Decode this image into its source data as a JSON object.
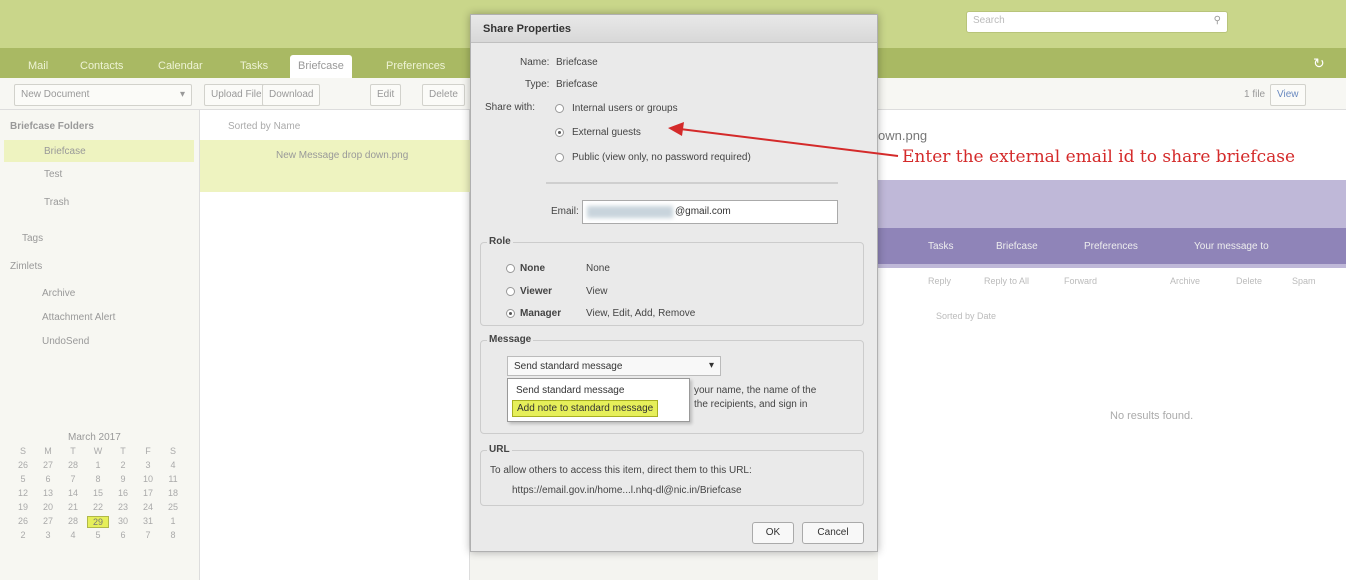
{
  "topbar": {
    "search_placeholder": "Search"
  },
  "nav": {
    "tabs": [
      "Mail",
      "Contacts",
      "Calendar",
      "Tasks",
      "Briefcase",
      "Preferences"
    ],
    "active": "Briefcase"
  },
  "toolbar": {
    "new_document": "New Document",
    "upload": "Upload File",
    "download": "Download",
    "edit": "Edit",
    "delete": "Delete",
    "file_count": "1 file",
    "view": "View"
  },
  "sidebar": {
    "folders_header": "Briefcase Folders",
    "folders": [
      "Briefcase",
      "Test",
      "Trash"
    ],
    "tags_header": "Tags",
    "zimlets_header": "Zimlets",
    "zimlets": [
      "Archive",
      "Attachment Alert",
      "UndoSend"
    ]
  },
  "calendar": {
    "month": "March 2017",
    "days": [
      "S",
      "M",
      "T",
      "W",
      "T",
      "F",
      "S"
    ],
    "weeks": [
      [
        "26",
        "27",
        "28",
        "1",
        "2",
        "3",
        "4"
      ],
      [
        "5",
        "6",
        "7",
        "8",
        "9",
        "10",
        "11"
      ],
      [
        "12",
        "13",
        "14",
        "15",
        "16",
        "17",
        "18"
      ],
      [
        "19",
        "20",
        "21",
        "22",
        "23",
        "24",
        "25"
      ],
      [
        "26",
        "27",
        "28",
        "29",
        "30",
        "31",
        "1"
      ],
      [
        "2",
        "3",
        "4",
        "5",
        "6",
        "7",
        "8"
      ]
    ],
    "today": "29"
  },
  "filelist": {
    "sort_label": "Sorted by Name",
    "file_name": "New Message drop down.png"
  },
  "preview": {
    "title_fragment": "own.png",
    "tabs": [
      "Tasks",
      "Briefcase",
      "Preferences",
      "Your message to"
    ],
    "actions": [
      "Reply",
      "Reply to All",
      "Forward",
      "Archive",
      "Delete",
      "Spam"
    ],
    "sort_label": "Sorted by Date",
    "no_results": "No results found."
  },
  "dialog": {
    "title": "Share Properties",
    "name_label": "Name:",
    "name_value": "Briefcase",
    "type_label": "Type:",
    "type_value": "Briefcase",
    "share_with_label": "Share with:",
    "share_options": [
      "Internal users or groups",
      "External guests",
      "Public (view only, no password required)"
    ],
    "share_selected": "External guests",
    "email_label": "Email:",
    "email_value": "@gmail.com",
    "role_legend": "Role",
    "roles": [
      {
        "name": "None",
        "desc": "None"
      },
      {
        "name": "Viewer",
        "desc": "View"
      },
      {
        "name": "Manager",
        "desc": "View, Edit, Add, Remove"
      }
    ],
    "role_selected": "Manager",
    "message_legend": "Message",
    "message_selected": "Send standard message",
    "message_options": [
      "Send standard message",
      "Add note to standard message"
    ],
    "message_highlight": "Add note to standard message",
    "message_note_1": "your name, the name of the",
    "message_note_2": "the recipients, and sign in",
    "url_legend": "URL",
    "url_desc": "To allow others to access this item, direct them to this URL:",
    "url_value": "https://email.gov.in/home...l.nhq-dl@nic.in/Briefcase",
    "ok": "OK",
    "cancel": "Cancel"
  },
  "annotation": {
    "text": "Enter the external email id to share briefcase",
    "color": "#d42a2a"
  }
}
